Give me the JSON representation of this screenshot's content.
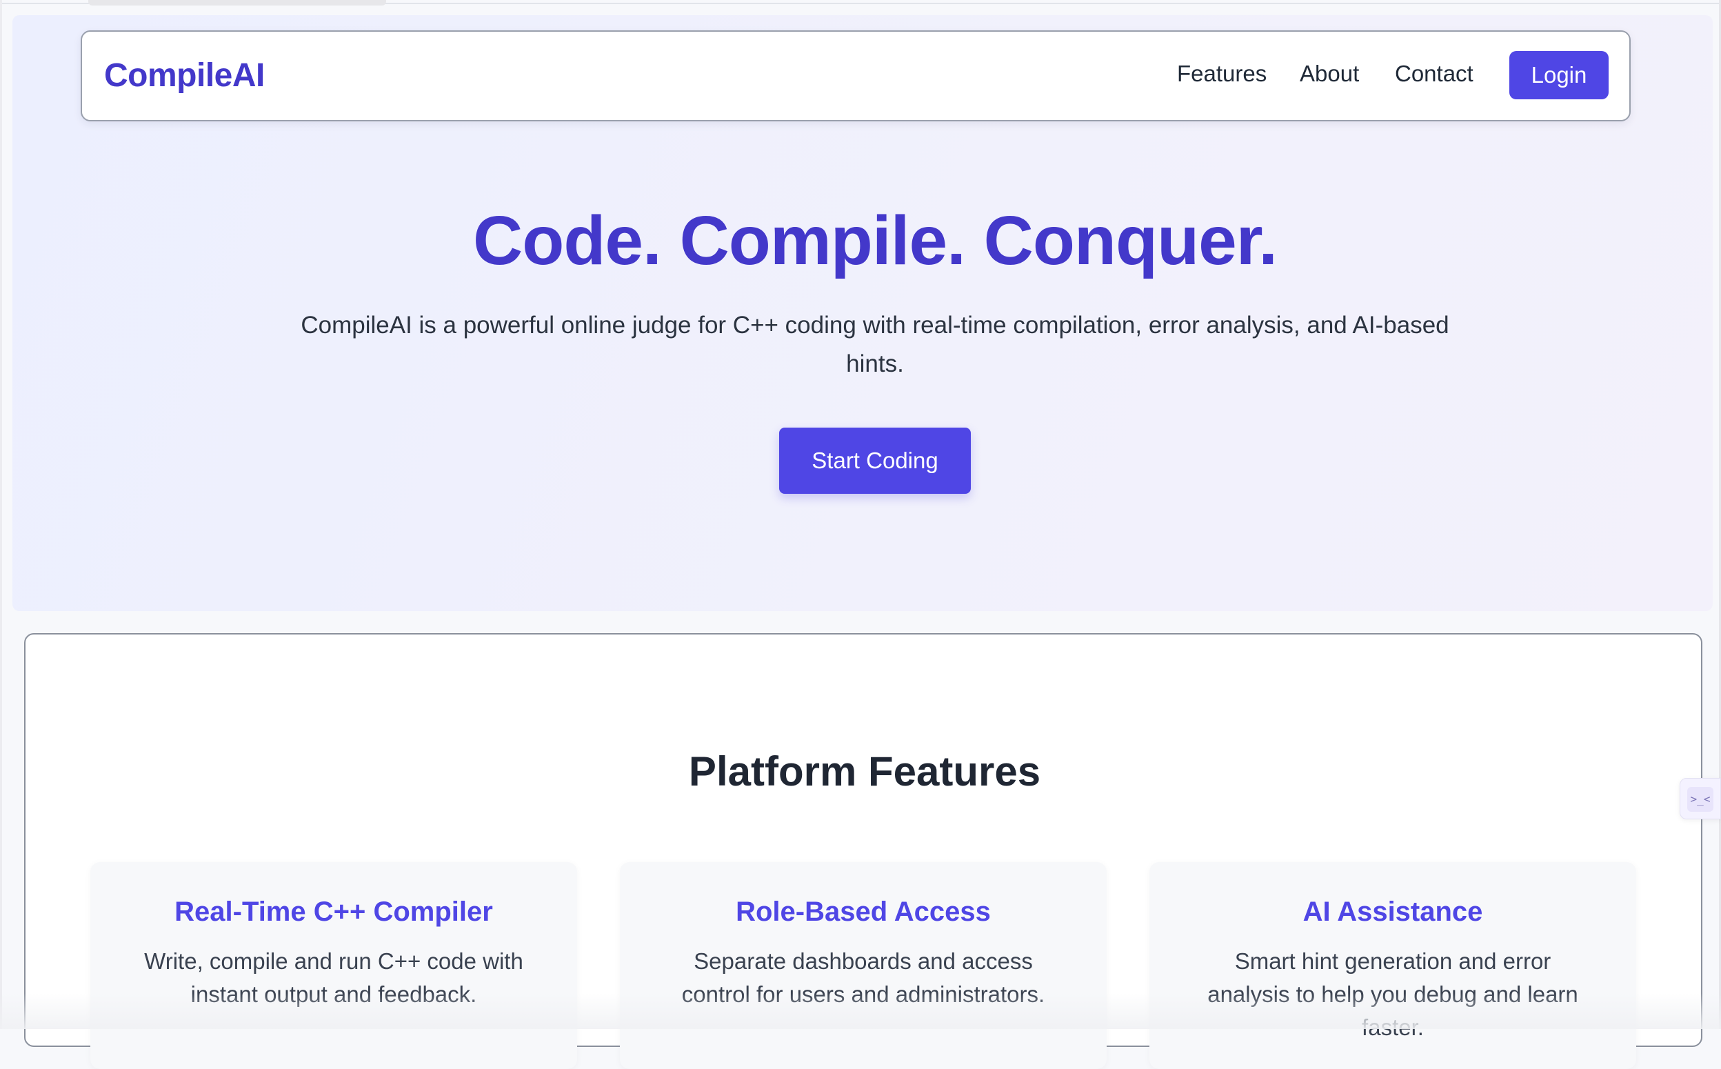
{
  "nav": {
    "brand": "CompileAI",
    "links": [
      "Features",
      "About",
      "Contact"
    ],
    "login": "Login"
  },
  "hero": {
    "title": "Code. Compile. Conquer.",
    "subtitle": "CompileAI is a powerful online judge for C++ coding with real-time compilation, error analysis, and AI-based hints.",
    "cta": "Start Coding"
  },
  "features": {
    "title": "Platform Features",
    "cards": [
      {
        "title": "Real-Time C++ Compiler",
        "desc": "Write, compile and run C++ code with instant output and feedback."
      },
      {
        "title": "Role-Based Access",
        "desc": "Separate dashboards and access control for users and administrators."
      },
      {
        "title": "AI Assistance",
        "desc": "Smart hint generation and error analysis to help you debug and learn faster."
      }
    ]
  },
  "widget": {
    "glyph": ">_<"
  },
  "colors": {
    "accent": "#4f46e5",
    "brand": "#4338ca",
    "hero_bg": "#eeeffd"
  }
}
